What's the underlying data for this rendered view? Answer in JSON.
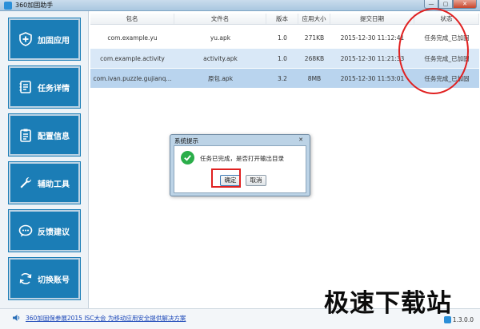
{
  "window": {
    "title": "360加固助手",
    "controls": {
      "minimize": "—",
      "maximize": "▢",
      "close": "✕"
    }
  },
  "sidebar": {
    "items": [
      {
        "label": "加固应用",
        "icon": "shield-plus-icon"
      },
      {
        "label": "任务详情",
        "icon": "task-list-icon"
      },
      {
        "label": "配置信息",
        "icon": "clipboard-icon"
      },
      {
        "label": "辅助工具",
        "icon": "wrench-icon"
      },
      {
        "label": "反馈建议",
        "icon": "chat-bubble-icon"
      },
      {
        "label": "切换账号",
        "icon": "switch-account-icon"
      }
    ]
  },
  "table": {
    "headers": [
      "包名",
      "文件名",
      "版本",
      "应用大小",
      "提交日期",
      "状态"
    ],
    "rows": [
      {
        "package": "com.example.yu",
        "file": "yu.apk",
        "version": "1.0",
        "size": "271KB",
        "date": "2015-12-30 11:12:41",
        "status": "任务完成_已加固"
      },
      {
        "package": "com.example.activity",
        "file": "activity.apk",
        "version": "1.0",
        "size": "268KB",
        "date": "2015-12-30 11:21:33",
        "status": "任务完成_已加固"
      },
      {
        "package": "com.ivan.puzzle.gujianq...",
        "file": "原包.apk",
        "version": "3.2",
        "size": "8MB",
        "date": "2015-12-30 11:53:01",
        "status": "任务完成_已加固"
      }
    ]
  },
  "dialog": {
    "title": "系统提示",
    "close": "✕",
    "message": "任务已完成，是否打开输出目录",
    "ok_label": "确定",
    "cancel_label": "取消"
  },
  "statusbar": {
    "news": "360加固保参展2015 ISC大会 为移动应用安全提供解决方案",
    "version": "1.3.0.0"
  },
  "watermark": "极速下载站",
  "colors": {
    "nav_bg": "#1b7db6",
    "annotation_red": "#e02020",
    "success_green": "#2bae4a",
    "row_selected": "#b9d4ee"
  }
}
